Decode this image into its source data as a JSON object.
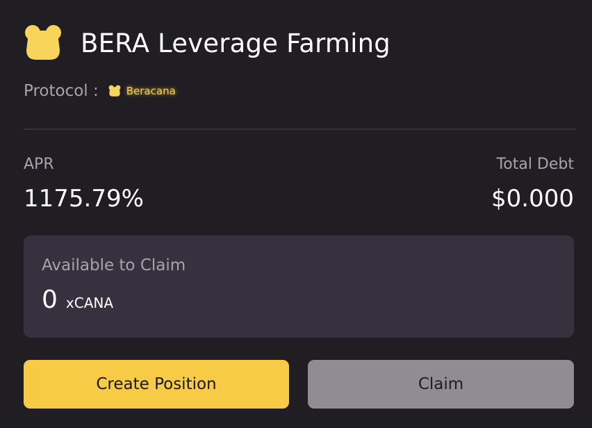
{
  "header": {
    "title": "BERA Leverage Farming",
    "logo_icon": "bear-head-icon"
  },
  "protocol": {
    "label": "Protocol :",
    "name": "Beracana",
    "icon": "bear-head-icon"
  },
  "stats": {
    "apr_label": "APR",
    "apr_value": "1175.79%",
    "debt_label": "Total Debt",
    "debt_value": "$0.000"
  },
  "claim": {
    "label": "Available to Claim",
    "amount": "0",
    "token": "xCANA"
  },
  "actions": {
    "create_label": "Create Position",
    "claim_label": "Claim"
  },
  "colors": {
    "background": "#201d23",
    "panel": "#36303f",
    "accent_yellow": "#f7cb45",
    "disabled_gray": "#8f8d93",
    "muted_text": "#a8a4ab"
  }
}
